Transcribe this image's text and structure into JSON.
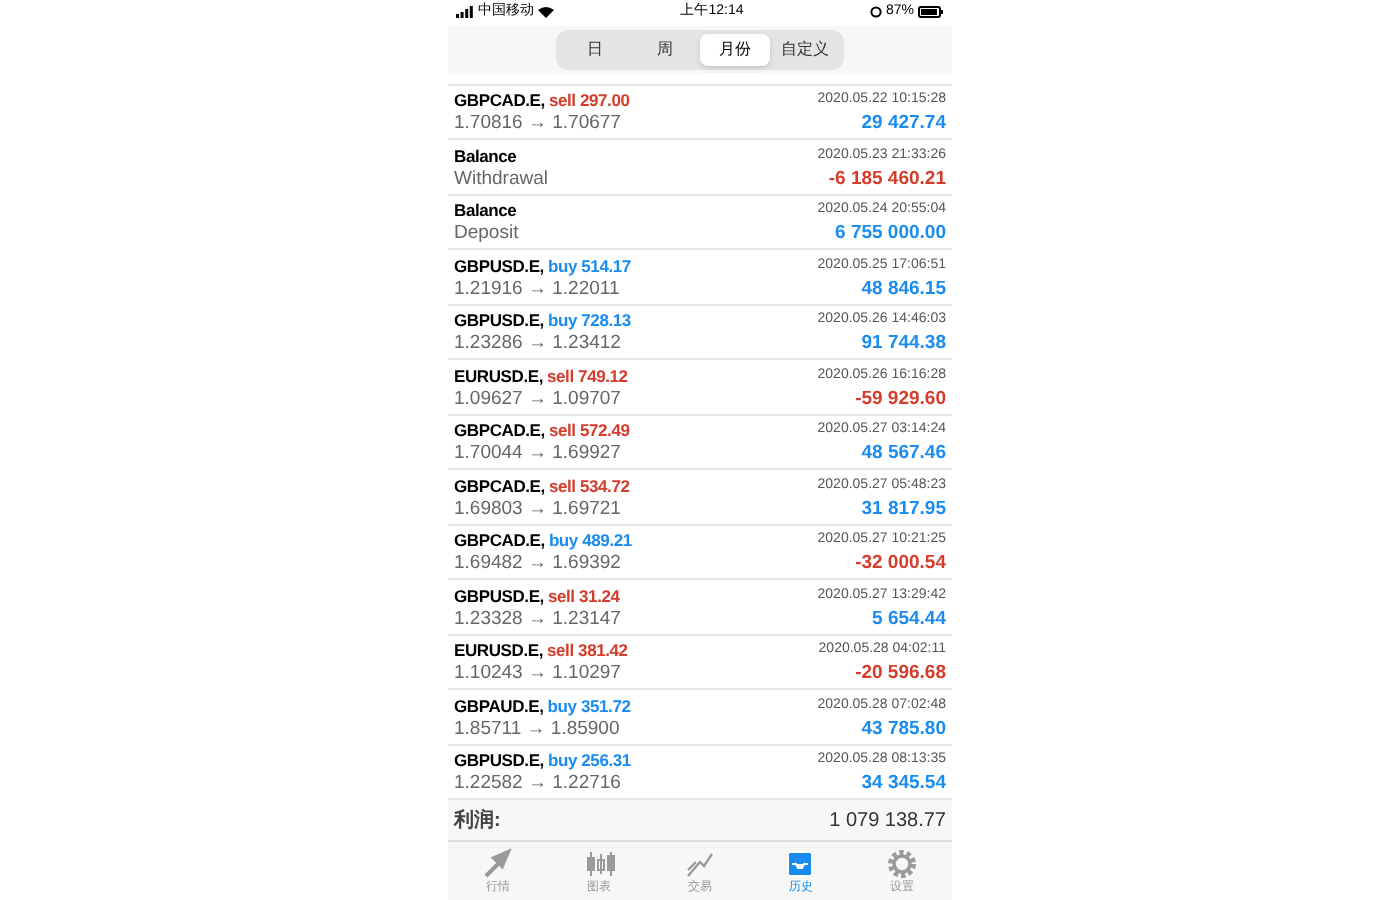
{
  "status_bar": {
    "carrier": "中国移动",
    "time": "上午12:14",
    "battery": "87%"
  },
  "period_tabs": [
    {
      "label": "日",
      "selected": false
    },
    {
      "label": "周",
      "selected": false
    },
    {
      "label": "月份",
      "selected": true
    },
    {
      "label": "自定义",
      "selected": false
    }
  ],
  "history": [
    {
      "kind": "trade",
      "symbol": "GBPCAD.E,",
      "action": {
        "text": "sell 297.00",
        "color": "#d43c2c"
      },
      "prices": "1.70816 → 1.70677",
      "time": "2020.05.22 10:15:28",
      "profit": "29 427.74",
      "negative": false
    },
    {
      "kind": "balance",
      "symbol": "Balance",
      "prices": "Withdrawal",
      "time": "2020.05.23 21:33:26",
      "profit": "-6 185 460.21",
      "negative": true
    },
    {
      "kind": "balance",
      "symbol": "Balance",
      "prices": "Deposit",
      "time": "2020.05.24 20:55:04",
      "profit": "6 755 000.00",
      "negative": false
    },
    {
      "kind": "trade",
      "symbol": "GBPUSD.E,",
      "action": {
        "text": "buy 514.17",
        "color": "#1a8cf0"
      },
      "prices": "1.21916 → 1.22011",
      "time": "2020.05.25 17:06:51",
      "profit": "48 846.15",
      "negative": false
    },
    {
      "kind": "trade",
      "symbol": "GBPUSD.E,",
      "action": {
        "text": "buy 728.13",
        "color": "#1a8cf0"
      },
      "prices": "1.23286 → 1.23412",
      "time": "2020.05.26 14:46:03",
      "profit": "91 744.38",
      "negative": false
    },
    {
      "kind": "trade",
      "symbol": "EURUSD.E,",
      "action": {
        "text": "sell 749.12",
        "color": "#d43c2c"
      },
      "prices": "1.09627 → 1.09707",
      "time": "2020.05.26 16:16:28",
      "profit": "-59 929.60",
      "negative": true
    },
    {
      "kind": "trade",
      "symbol": "GBPCAD.E,",
      "action": {
        "text": "sell 572.49",
        "color": "#d43c2c"
      },
      "prices": "1.70044 → 1.69927",
      "time": "2020.05.27 03:14:24",
      "profit": "48 567.46",
      "negative": false
    },
    {
      "kind": "trade",
      "symbol": "GBPCAD.E,",
      "action": {
        "text": "sell 534.72",
        "color": "#d43c2c"
      },
      "prices": "1.69803 → 1.69721",
      "time": "2020.05.27 05:48:23",
      "profit": "31 817.95",
      "negative": false
    },
    {
      "kind": "trade",
      "symbol": "GBPCAD.E,",
      "action": {
        "text": "buy 489.21",
        "color": "#1a8cf0"
      },
      "prices": "1.69482 → 1.69392",
      "time": "2020.05.27 10:21:25",
      "profit": "-32 000.54",
      "negative": true
    },
    {
      "kind": "trade",
      "symbol": "GBPUSD.E,",
      "action": {
        "text": "sell 31.24",
        "color": "#d43c2c"
      },
      "prices": "1.23328 → 1.23147",
      "time": "2020.05.27 13:29:42",
      "profit": "5 654.44",
      "negative": false
    },
    {
      "kind": "trade",
      "symbol": "EURUSD.E,",
      "action": {
        "text": "sell 381.42",
        "color": "#d43c2c"
      },
      "prices": "1.10243 → 1.10297",
      "time": "2020.05.28 04:02:11",
      "profit": "-20 596.68",
      "negative": true
    },
    {
      "kind": "trade",
      "symbol": "GBPAUD.E,",
      "action": {
        "text": "buy 351.72",
        "color": "#1a8cf0"
      },
      "prices": "1.85711 → 1.85900",
      "time": "2020.05.28 07:02:48",
      "profit": "43 785.80",
      "negative": false
    },
    {
      "kind": "trade",
      "symbol": "GBPUSD.E,",
      "action": {
        "text": "buy 256.31",
        "color": "#1a8cf0"
      },
      "prices": "1.22582 → 1.22716",
      "time": "2020.05.28 08:13:35",
      "profit": "34 345.54",
      "negative": false
    }
  ],
  "summary": {
    "label": "利润:",
    "value": "1 079 138.77"
  },
  "bottom_tabs": [
    {
      "label": "行情",
      "selected": false
    },
    {
      "label": "图表",
      "selected": false
    },
    {
      "label": "交易",
      "selected": false
    },
    {
      "label": "历史",
      "selected": true
    },
    {
      "label": "设置",
      "selected": false
    }
  ]
}
